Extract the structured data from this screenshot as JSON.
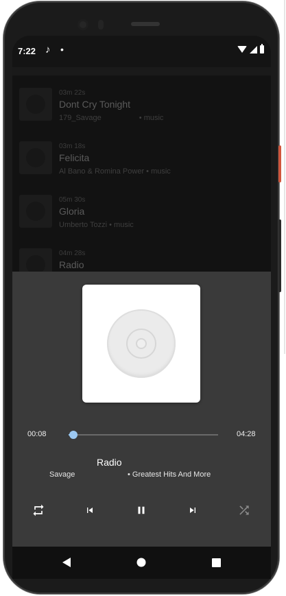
{
  "status_bar": {
    "time": "7:22",
    "music_icon": "music-note-icon",
    "dot": "•",
    "icons": [
      "wifi-icon",
      "signal-icon",
      "battery-icon"
    ]
  },
  "track_list": [
    {
      "duration": "03m 22s",
      "title": "Dont Cry Tonight",
      "meta": "179_Savage                  • music"
    },
    {
      "duration": "03m 18s",
      "title": "Felicita",
      "meta": "Al Bano & Romina Power • music"
    },
    {
      "duration": "05m 30s",
      "title": "Gloria",
      "meta": "Umberto Tozzi • music"
    },
    {
      "duration": "04m 28s",
      "title": "Radio",
      "meta": ""
    }
  ],
  "player": {
    "album_art_icon": "disc-icon",
    "elapsed": "00:08",
    "total": "04:28",
    "progress_fraction": 0.03,
    "title": "Radio",
    "artist": "Savage",
    "album": "• Greatest Hits And More",
    "controls": [
      "repeat-icon",
      "skip-previous-icon",
      "pause-icon",
      "skip-next-icon",
      "shuffle-icon"
    ]
  },
  "nav": [
    "back-icon",
    "home-icon",
    "recents-icon"
  ],
  "colors": {
    "accent": "#9cc8f2",
    "player_bg": "#3a3a3a",
    "list_bg": "#121212"
  }
}
